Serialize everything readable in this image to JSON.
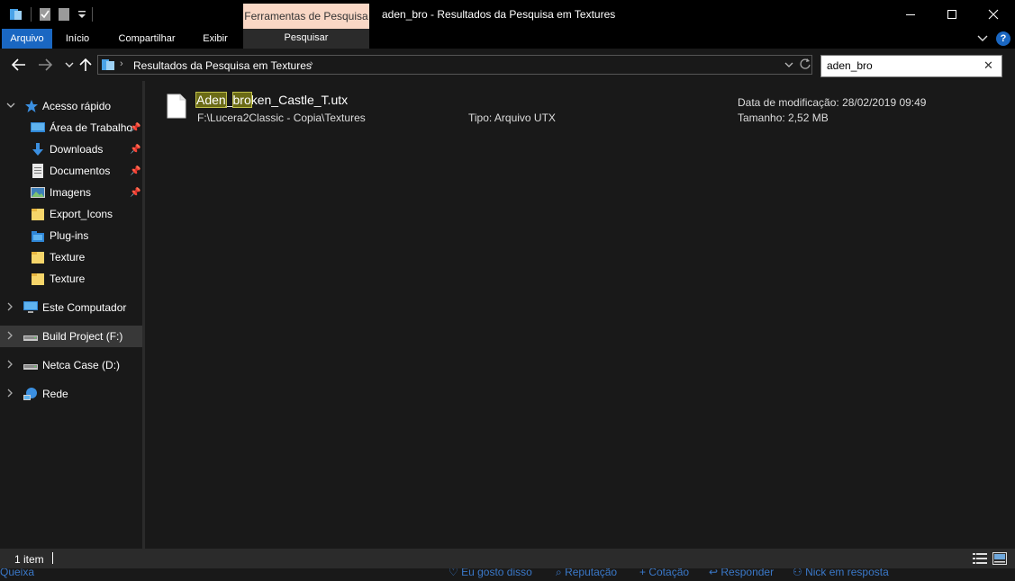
{
  "titlebar": {
    "context_tab_header": "Ferramentas de Pesquisa",
    "window_title": "aden_bro - Resultados da Pesquisa em Textures",
    "icons": [
      "folder-icon",
      "properties-icon",
      "new-folder-icon",
      "customize-dropdown-icon",
      "minimize-icon",
      "maximize-icon",
      "close-icon"
    ]
  },
  "ribbon": {
    "tabs": [
      {
        "label": "Arquivo"
      },
      {
        "label": "Início"
      },
      {
        "label": "Compartilhar"
      },
      {
        "label": "Exibir"
      },
      {
        "label": "Pesquisar"
      }
    ],
    "help_label": "?",
    "accent": "#1a67c2",
    "context_color": "#f9d7c5"
  },
  "address": {
    "path_text": "Resultados da Pesquisa em Textures",
    "search_value": "aden_bro"
  },
  "sidebar": {
    "quick_access": {
      "label": "Acesso rápido"
    },
    "items": [
      {
        "label": "Área de Trabalho",
        "icon": "desktop-icon",
        "pinned": true
      },
      {
        "label": "Downloads",
        "icon": "download-icon",
        "pinned": true
      },
      {
        "label": "Documentos",
        "icon": "document-icon",
        "pinned": true
      },
      {
        "label": "Imagens",
        "icon": "image-icon",
        "pinned": true
      },
      {
        "label": "Export_Icons",
        "icon": "folder-icon",
        "pinned": false
      },
      {
        "label": "Plug-ins",
        "icon": "plugin-folder-icon",
        "pinned": false
      },
      {
        "label": "Texture",
        "icon": "folder-icon",
        "pinned": false
      },
      {
        "label": "Texture",
        "icon": "folder-icon",
        "pinned": false
      }
    ],
    "roots": [
      {
        "label": "Este Computador",
        "icon": "computer-icon"
      },
      {
        "label": "Build Project (F:)",
        "icon": "drive-icon",
        "selected": true
      },
      {
        "label": "Netca Case (D:)",
        "icon": "drive-icon"
      },
      {
        "label": "Rede",
        "icon": "network-icon"
      }
    ]
  },
  "results": [
    {
      "name_highlight_1": "Aden",
      "name_sep": "_",
      "name_highlight_2": "bro",
      "name_rest": "ken_Castle_T.utx",
      "path": "F:\\Lucera2Classic - Copia\\Textures",
      "type": "Tipo: Arquivo UTX",
      "modified": "Data de modificação: 28/02/2019 09:49",
      "size": "Tamanho: 2,52 MB"
    }
  ],
  "status": {
    "count": "1 item"
  },
  "forum_strip": {
    "items": [
      "Queixa",
      "Eu gosto disso",
      "Reputação",
      "+ Cotação",
      "Responder",
      "Nick em resposta"
    ]
  }
}
